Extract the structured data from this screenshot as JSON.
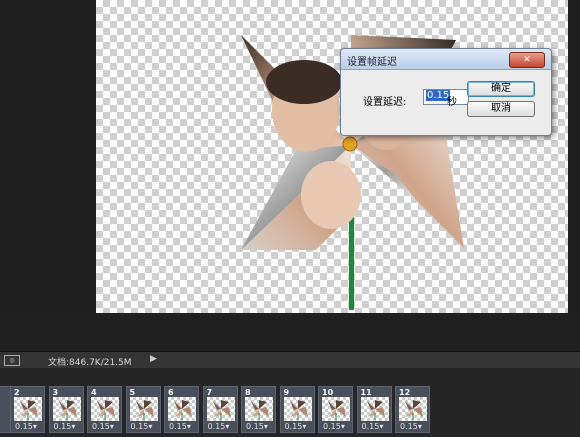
{
  "dialog": {
    "title": "设置帧延迟",
    "close": "✕",
    "label": "设置延迟:",
    "value": "0.15",
    "unit": "秒",
    "ok": "确定",
    "cancel": "取消"
  },
  "statusbar": {
    "doc_info": "文档:846.7K/21.5M",
    "arrow": "▶"
  },
  "timeline": {
    "frames": [
      {
        "num": "2",
        "delay": "0.15▾"
      },
      {
        "num": "3",
        "delay": "0.15▾"
      },
      {
        "num": "4",
        "delay": "0.15▾"
      },
      {
        "num": "5",
        "delay": "0.15▾"
      },
      {
        "num": "6",
        "delay": "0.15▾"
      },
      {
        "num": "7",
        "delay": "0.15▾"
      },
      {
        "num": "8",
        "delay": "0.15▾"
      },
      {
        "num": "9",
        "delay": "0.15▾"
      },
      {
        "num": "10",
        "delay": "0.15▾"
      },
      {
        "num": "11",
        "delay": "0.15▾"
      },
      {
        "num": "12",
        "delay": "0.15▾"
      }
    ]
  },
  "colors": {
    "stick": "#1a8a3a",
    "center_pin": "#e0a020",
    "selection": "#3068c8"
  }
}
